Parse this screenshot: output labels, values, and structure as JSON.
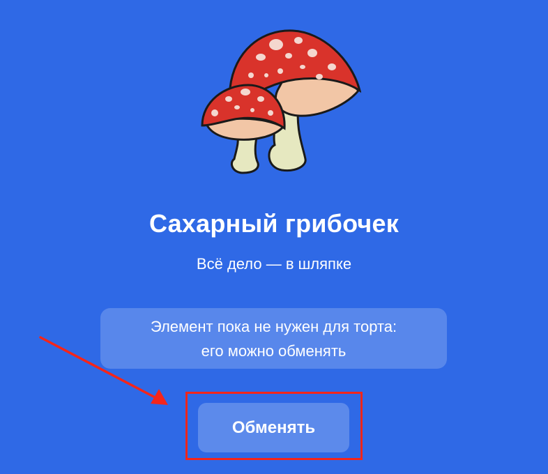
{
  "card": {
    "illustration_icon": "fly-agaric-mushrooms-icon",
    "title": "Сахарный грибочек",
    "subtitle": "Всё дело — в шляпке",
    "notice_line1": "Элемент пока не нужен для торта:",
    "notice_line2": "его можно обменять",
    "exchange_label": "Обменять"
  },
  "colors": {
    "background": "#2f69e6",
    "text": "#ffffff",
    "highlight": "#f5251a",
    "cap": "#d9332b",
    "stem": "#e6e8c0"
  }
}
